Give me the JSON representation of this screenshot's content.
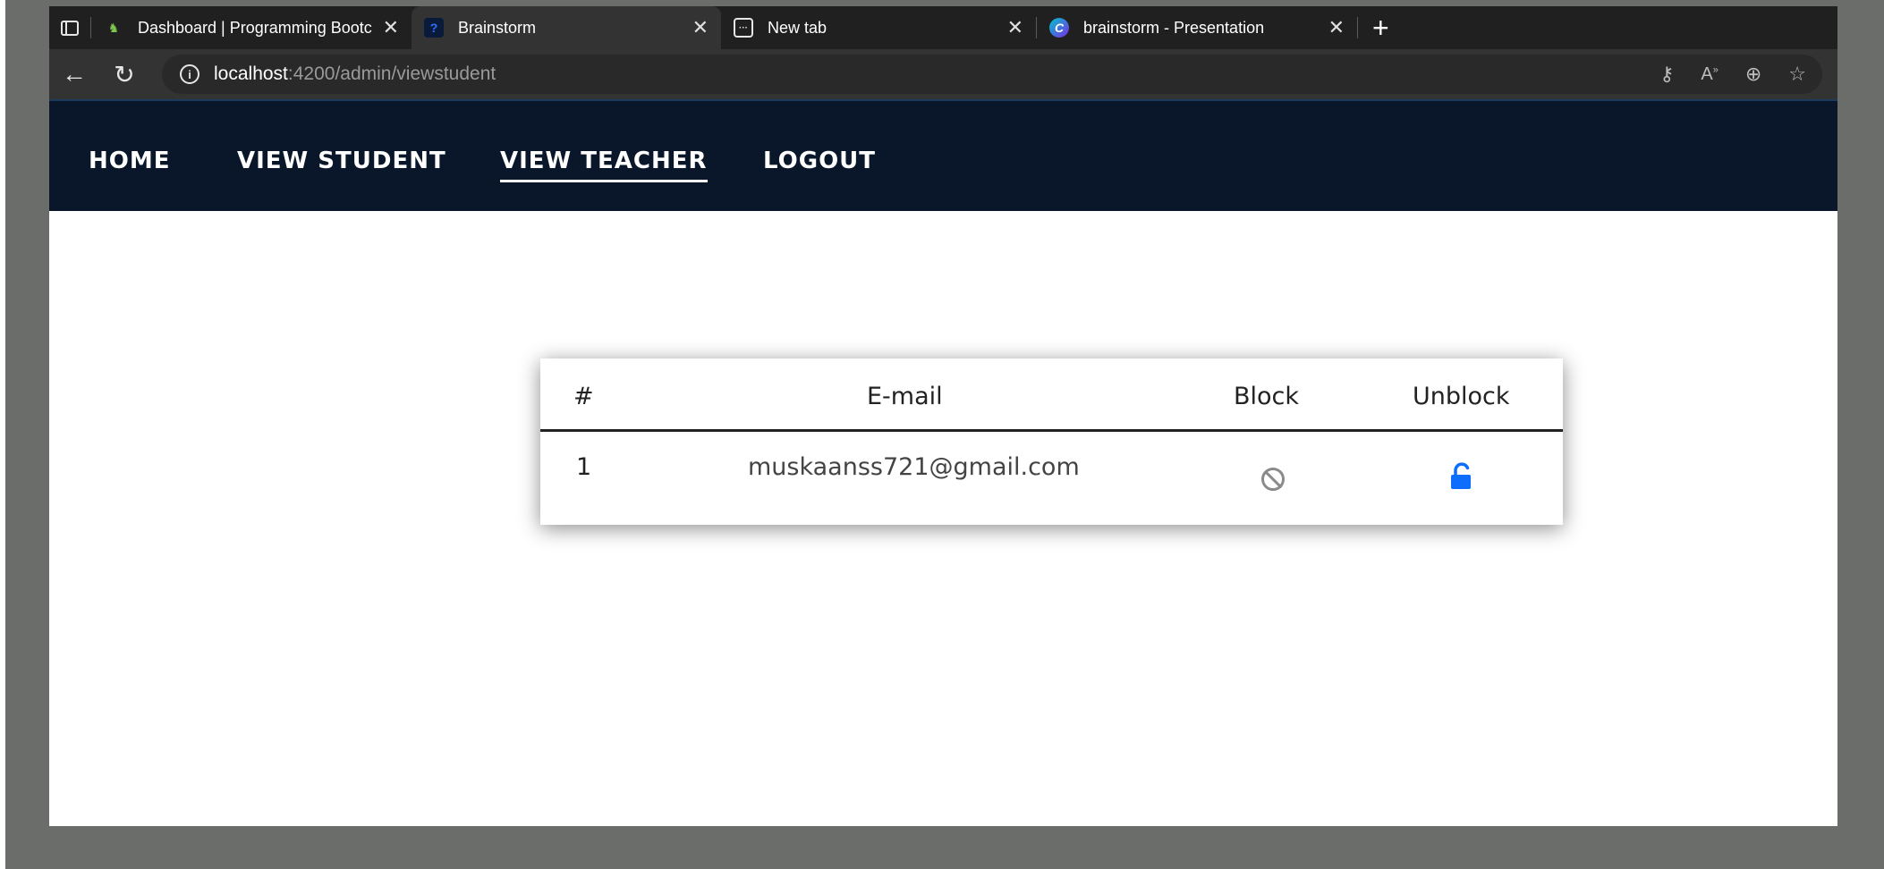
{
  "browser": {
    "tabs": [
      {
        "title": "Dashboard | Programming Bootc",
        "icon": "bootcamp-logo-icon",
        "active": false
      },
      {
        "title": "Brainstorm",
        "icon": "brainstorm-favicon-icon",
        "active": true
      },
      {
        "title": "New tab",
        "icon": "new-tab-icon",
        "active": false
      },
      {
        "title": "brainstorm - Presentation",
        "icon": "canva-icon",
        "active": false
      }
    ],
    "url_host": "localhost",
    "url_path": ":4200/admin/viewstudent"
  },
  "navbar": {
    "items": [
      {
        "label": "HOME"
      },
      {
        "label": "VIEW STUDENT"
      },
      {
        "label": "VIEW TEACHER",
        "active": true
      },
      {
        "label": "LOGOUT"
      }
    ]
  },
  "table": {
    "headers": {
      "index": "#",
      "email": "E-mail",
      "block": "Block",
      "unblock": "Unblock"
    },
    "rows": [
      {
        "index": "1",
        "email": "muskaanss721@gmail.com"
      }
    ]
  },
  "colors": {
    "navbar_bg": "#0a172b",
    "unlock_blue": "#0d6efd",
    "block_grey": "#8a8a8a"
  }
}
